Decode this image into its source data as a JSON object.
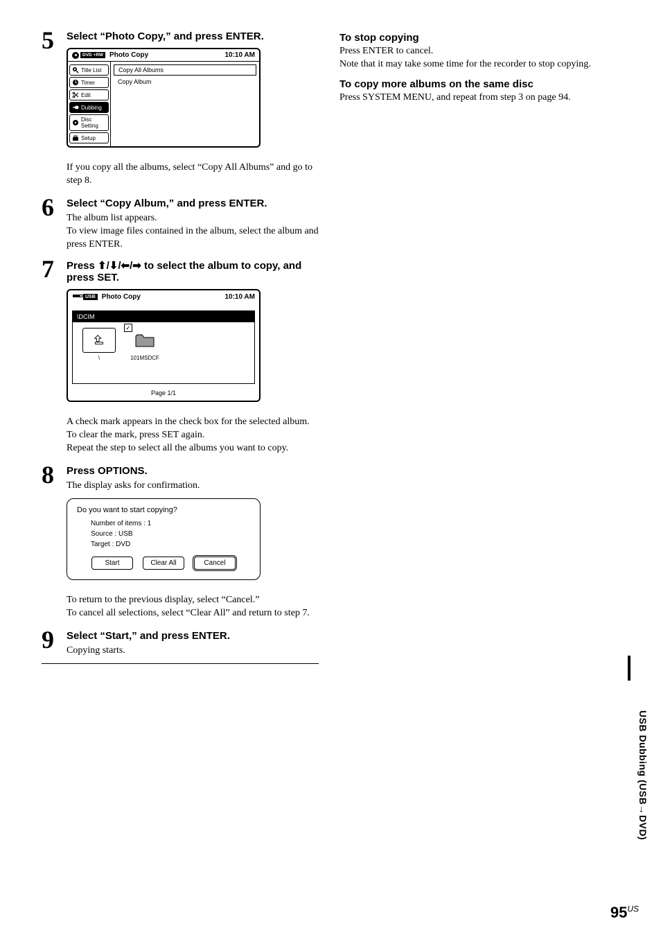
{
  "steps": {
    "s5": {
      "num": "5",
      "title": "Select “Photo Copy,” and press ENTER."
    },
    "s5_post": "If you copy all the albums, select “Copy All Albums” and go to step 8.",
    "s6": {
      "num": "6",
      "title": "Select “Copy Album,” and press ENTER.",
      "body": "The album list appears.\nTo view image files contained in the album, select the album and press ENTER."
    },
    "s7": {
      "num": "7",
      "title_pre": "Press ",
      "title_arrows": "↑/↓/←/→",
      "title_post": " to select the album to copy, and press SET."
    },
    "s7_post": "A check mark appears in the check box for the selected album. To clear the mark, press SET again.\nRepeat the step to select all the albums you want to copy.",
    "s8": {
      "num": "8",
      "title": "Press OPTIONS.",
      "body": "The display asks for confirmation."
    },
    "s8_post": "To return to the previous display, select “Cancel.”\nTo cancel all selections, select “Clear All” and return to step 7.",
    "s9": {
      "num": "9",
      "title": "Select “Start,” and press ENTER.",
      "body": "Copying starts."
    }
  },
  "ui1": {
    "disc_label": "DVD +RW",
    "title": "Photo Copy",
    "time": "10:10 AM",
    "side": [
      "Title List",
      "Timer",
      "Edit",
      "Dubbing",
      "Disc Setting",
      "Setup"
    ],
    "opts": [
      "Copy All Albums",
      "Copy Album"
    ]
  },
  "ui2": {
    "badge": "USB",
    "title": "Photo Copy",
    "time": "10:10 AM",
    "breadcrumb": "\\DCIM",
    "up_label": "\\",
    "folder_label": "101MSDCF",
    "check": "✓",
    "page": "Page 1/1"
  },
  "ui3": {
    "question": "Do you want to start copying?",
    "lines": [
      "Number of items : 1",
      "Source : USB",
      "Target  : DVD"
    ],
    "buttons": [
      "Start",
      "Clear All",
      "Cancel"
    ]
  },
  "right": {
    "stop_h": "To stop copying",
    "stop_b": "Press ENTER to cancel.\nNote that it may take some time for the recorder to stop copying.",
    "more_h": "To copy more albums on the same disc",
    "more_b": "Press SYSTEM MENU, and repeat from step 3 on page 94."
  },
  "side_tab_pre": "USB Dubbing (USB ",
  "side_tab_arrow": "→",
  "side_tab_post": " DVD)",
  "page_num": "95",
  "page_suffix": "US"
}
